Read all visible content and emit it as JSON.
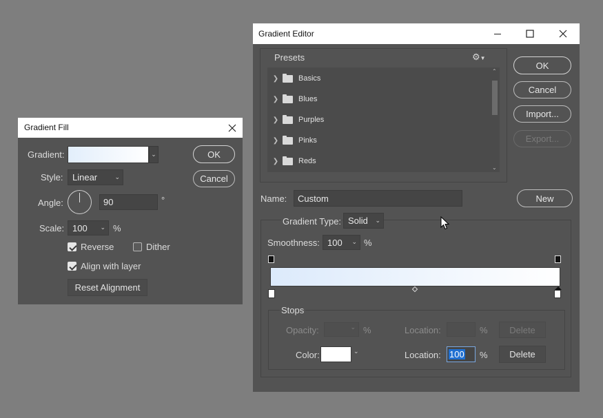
{
  "gradient_fill": {
    "title": "Gradient Fill",
    "close_icon": "close-icon",
    "gradient_label": "Gradient:",
    "style_label": "Style:",
    "style_value": "Linear",
    "angle_label": "Angle:",
    "angle_value": "90",
    "degree_symbol": "°",
    "scale_label": "Scale:",
    "scale_value": "100",
    "percent": "%",
    "reverse_label": "Reverse",
    "reverse_checked": true,
    "dither_label": "Dither",
    "dither_checked": false,
    "align_label": "Align with layer",
    "align_checked": true,
    "reset_alignment_label": "Reset Alignment",
    "ok_label": "OK",
    "cancel_label": "Cancel"
  },
  "gradient_editor": {
    "title": "Gradient Editor",
    "presets_label": "Presets",
    "gear_icon": "gear-icon",
    "presets": [
      {
        "label": "Basics"
      },
      {
        "label": "Blues"
      },
      {
        "label": "Purples"
      },
      {
        "label": "Pinks"
      },
      {
        "label": "Reds"
      }
    ],
    "ok_label": "OK",
    "cancel_label": "Cancel",
    "import_label": "Import...",
    "export_label": "Export...",
    "name_label": "Name:",
    "name_value": "Custom",
    "new_label": "New",
    "gradient_type_label": "Gradient Type:",
    "gradient_type_value": "Solid",
    "smoothness_label": "Smoothness:",
    "smoothness_value": "100",
    "percent": "%",
    "stops_label": "Stops",
    "opacity_label": "Opacity:",
    "color_label": "Color:",
    "location_label": "Location:",
    "location_opacity_value": "",
    "location_color_value": "100",
    "delete_label": "Delete",
    "gradient_start_color": "#dceafb",
    "gradient_end_color": "#ffffff"
  },
  "colors": {
    "desktop": "#7e7e7e",
    "dialog": "#535353",
    "titlebar": "#ffffff",
    "selection": "#1f6fd1"
  }
}
